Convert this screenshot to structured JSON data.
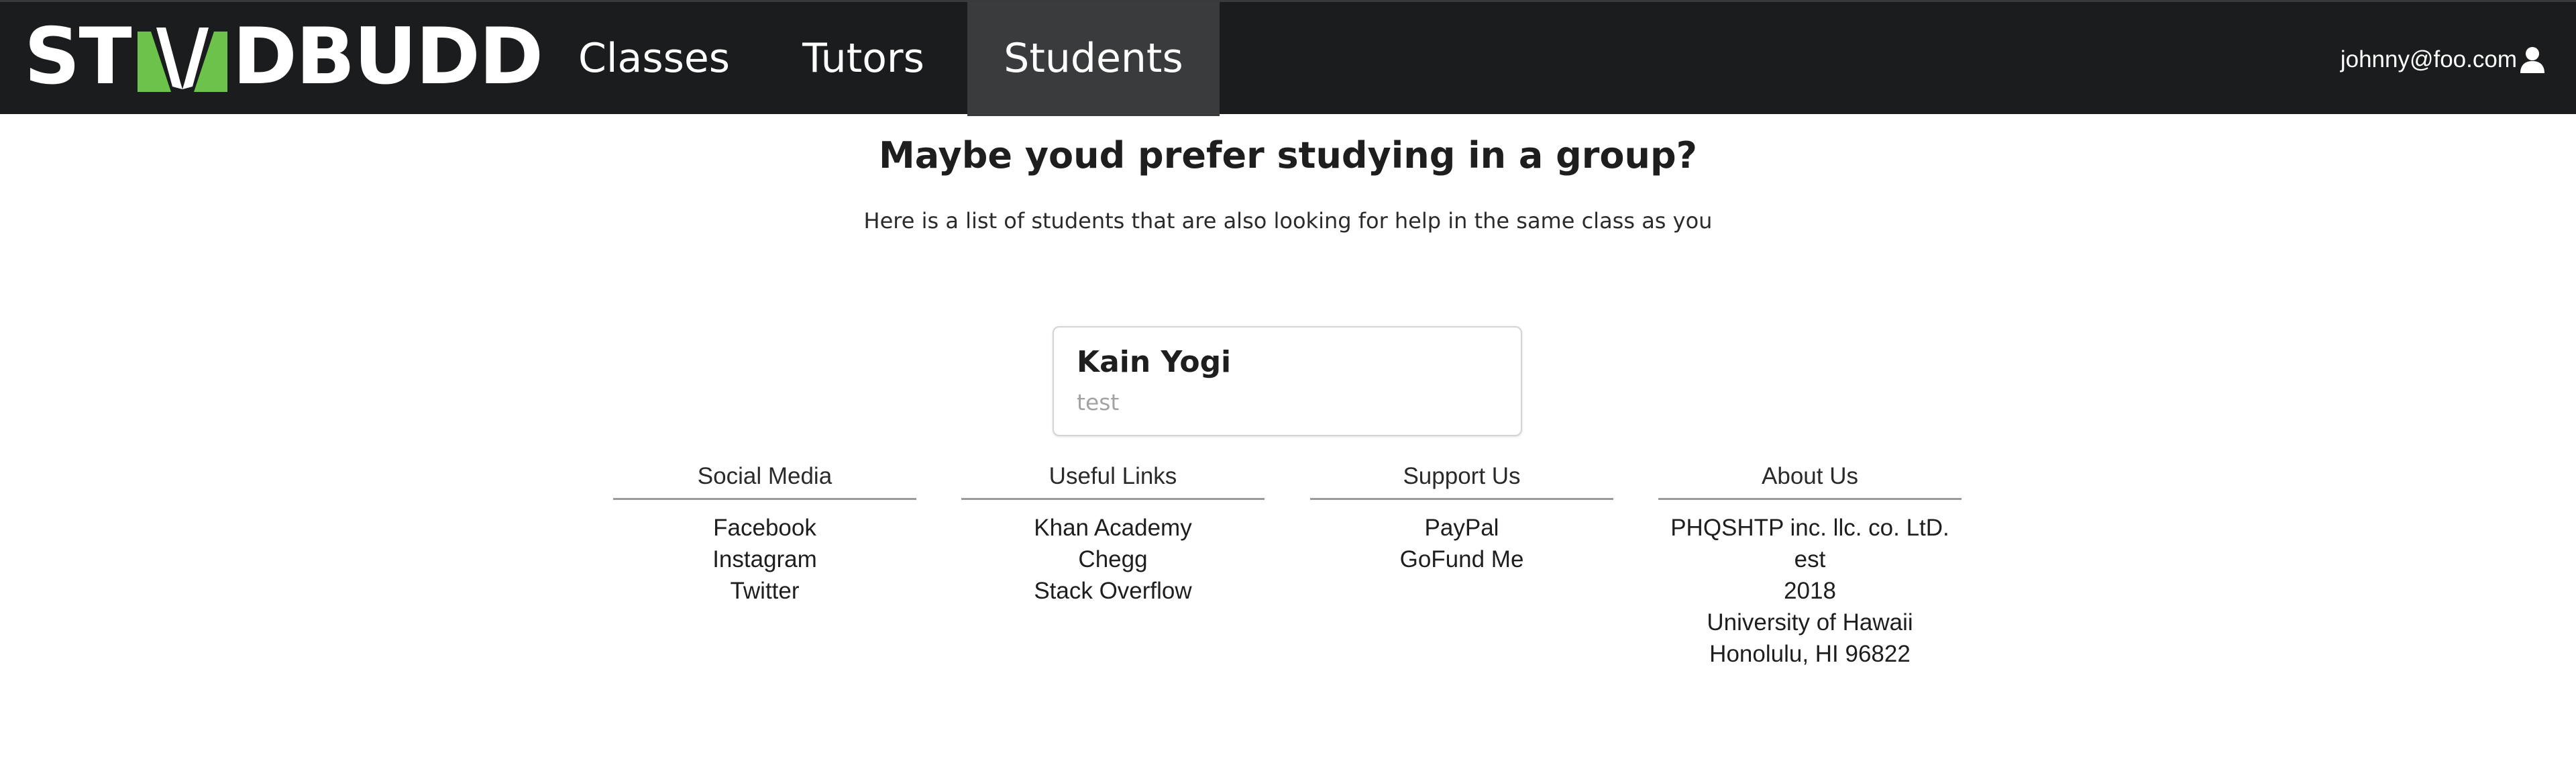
{
  "nav": {
    "logo_text": [
      "ST",
      "DBUDD"
    ],
    "items": [
      {
        "label": "Classes",
        "active": false
      },
      {
        "label": "Tutors",
        "active": false
      },
      {
        "label": "Students",
        "active": true
      }
    ],
    "user_email": "johnny@foo.com",
    "user_icon": "user-icon",
    "accent_color": "#6cc24a"
  },
  "main": {
    "title": "Maybe youd prefer studying in a group?",
    "subtitle": "Here is a list of students that are also looking for help in the same class as you",
    "students": [
      {
        "name": "Kain Yogi",
        "meta": "test"
      }
    ]
  },
  "footer": {
    "columns": [
      {
        "heading": "Social Media",
        "lines": [
          "Facebook",
          "Instagram",
          "Twitter"
        ]
      },
      {
        "heading": "Useful Links",
        "lines": [
          "Khan Academy",
          "Chegg",
          "Stack Overflow"
        ]
      },
      {
        "heading": "Support Us",
        "lines": [
          "PayPal",
          "GoFund Me"
        ]
      },
      {
        "heading": "About Us",
        "lines": [
          "PHQSHTP inc. llc. co. LtD. est",
          "2018",
          "University of Hawaii",
          "Honolulu, HI 96822"
        ]
      }
    ]
  }
}
